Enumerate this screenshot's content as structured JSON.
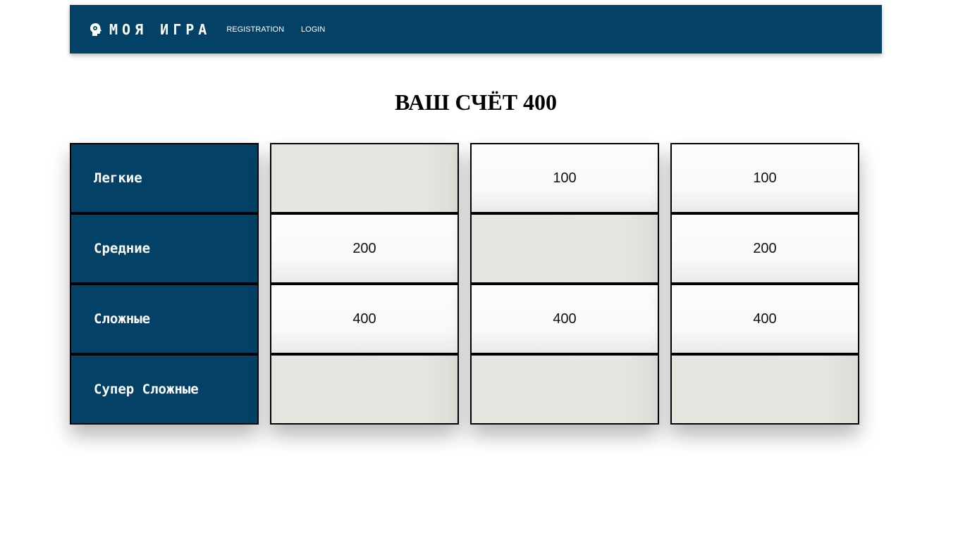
{
  "nav": {
    "brand_icon": "brain-head-icon",
    "brand": "МОЯ ИГРА",
    "links": [
      "REGISTRATION",
      "LOGIN"
    ]
  },
  "score": {
    "text": "ВАШ СЧЁТ 400"
  },
  "board": {
    "categories": [
      "Легкие",
      "Средние",
      "Сложные",
      "Супер Сложные"
    ],
    "rows": [
      [
        "",
        "100",
        "100"
      ],
      [
        "200",
        "",
        "200"
      ],
      [
        "400",
        "400",
        "400"
      ],
      [
        "",
        "",
        ""
      ]
    ]
  },
  "colors": {
    "primary": "#034266",
    "cell_available": "#faf8fa",
    "cell_used": "#e6e5e0"
  }
}
